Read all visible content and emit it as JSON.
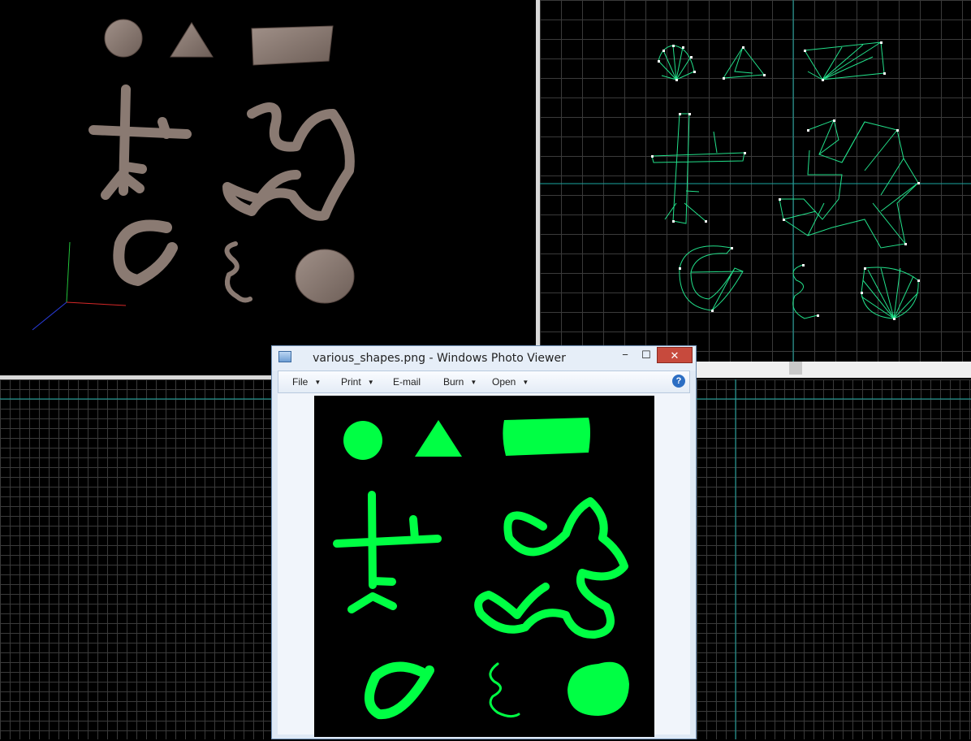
{
  "photo_viewer": {
    "title": "various_shapes.png - Windows Photo Viewer",
    "window_controls": {
      "minimize": "−",
      "maximize": "☐",
      "close": "✕"
    },
    "menu": [
      {
        "label": "File",
        "has_dropdown": true
      },
      {
        "label": "Print",
        "has_dropdown": true
      },
      {
        "label": "E-mail",
        "has_dropdown": false
      },
      {
        "label": "Burn",
        "has_dropdown": true
      },
      {
        "label": "Open",
        "has_dropdown": true
      }
    ],
    "help_label": "?",
    "image_name": "various_shapes.png"
  },
  "viewports": {
    "perspective": {
      "background": "#000000",
      "shape_texture_color": "#8a7a72"
    },
    "top": {
      "background": "#000000",
      "wire_color": "#22e08a",
      "vertex_color": "#ffffff"
    },
    "bottom_left": {
      "label": "",
      "background": "#000000"
    },
    "bottom_right": {
      "label": "",
      "background": "#000000"
    }
  },
  "colors": {
    "shape_fill": "#00ff44",
    "viewport_divider": "#d9d9d9",
    "close_button": "#c74a3d"
  },
  "icons": [
    "photo-viewer-app-icon",
    "minimize-icon",
    "maximize-icon",
    "close-icon",
    "help-icon",
    "dropdown-caret-icon",
    "axis-gizmo-icon"
  ]
}
